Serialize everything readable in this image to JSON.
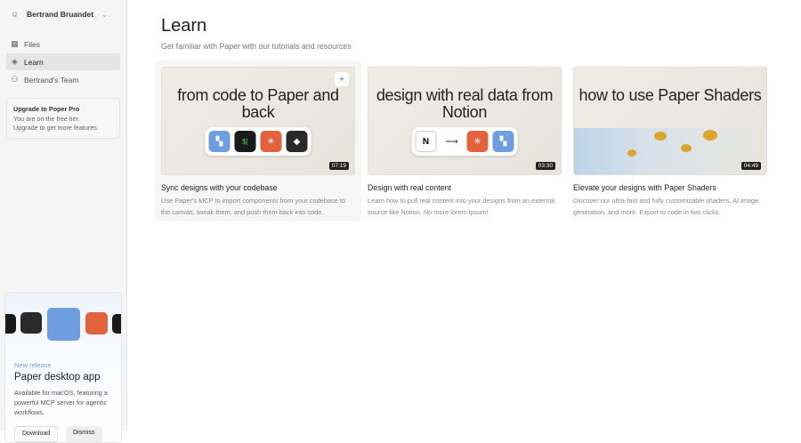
{
  "sidebar": {
    "user_name": "Bertrand Bruandet",
    "items": [
      {
        "label": "Files",
        "icon": "grid-icon"
      },
      {
        "label": "Learn",
        "icon": "graduation-cap-icon"
      },
      {
        "label": "Bertrand's Team",
        "icon": "team-icon"
      }
    ],
    "upgrade": {
      "title": "Upgrade to Poper Pro",
      "line1": "You are on the free tier.",
      "line2": "Upgrade to get more features."
    },
    "release": {
      "label": "New release",
      "title": "Paper desktop app",
      "desc": "Available for macOS, featuring a powerful MCP server for agentic workflows.",
      "primary": "Download",
      "secondary": "Dismiss"
    }
  },
  "main": {
    "title": "Learn",
    "subtitle": "Get familiar with Paper with our tutorials and resources",
    "cards": [
      {
        "thumb_text": "from code to Paper and back",
        "duration": "07:19",
        "title": "Sync designs with your codebase",
        "desc": "Use Paper's MCP to import components from your codebase to the canvas, tweak them, and push them back into code."
      },
      {
        "thumb_text": "design with real data from Notion",
        "duration": "03:30",
        "title": "Design with real content",
        "desc": "Learn how to pull real content into your designs from an external source like Notion. No more lorem ipsum!"
      },
      {
        "thumb_text": "how to use Paper Shaders",
        "duration": "04:49",
        "title": "Elevate your designs with Paper Shaders",
        "desc": "Discover our ultra-fast and fully customizable shaders, AI image generation, and more. Export to code in two clicks."
      }
    ]
  }
}
